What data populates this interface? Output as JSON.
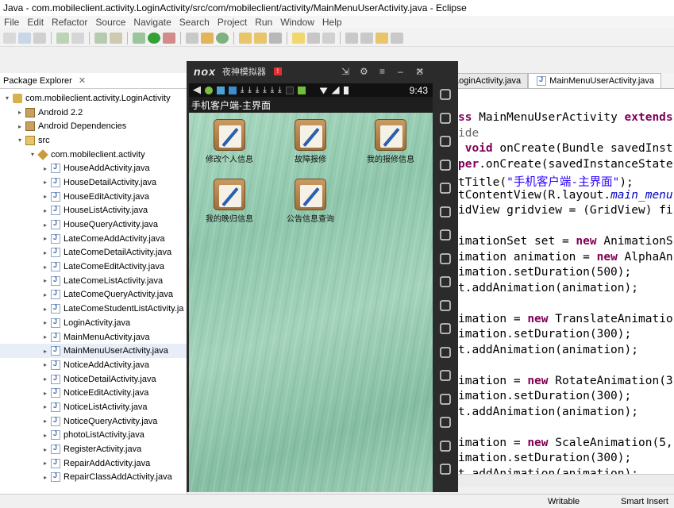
{
  "window": {
    "title": "Java - com.mobileclient.activity.LoginActivity/src/com/mobileclient/activity/MainMenuUserActivity.java - Eclipse"
  },
  "menu": [
    "File",
    "Edit",
    "Refactor",
    "Source",
    "Navigate",
    "Search",
    "Project",
    "Run",
    "Window",
    "Help"
  ],
  "explorer": {
    "title": "Package Explorer",
    "close": "✕",
    "items": [
      {
        "label": "com.mobileclient.activity.LoginActivity",
        "indent": 0,
        "icon": "project-icon",
        "twisty": "▾"
      },
      {
        "label": "Android 2.2",
        "indent": 1,
        "icon": "library-icon",
        "twisty": "▸"
      },
      {
        "label": "Android Dependencies",
        "indent": 1,
        "icon": "library-icon",
        "twisty": "▸"
      },
      {
        "label": "src",
        "indent": 1,
        "icon": "source-folder-icon",
        "twisty": "▾"
      },
      {
        "label": "com.mobileclient.activity",
        "indent": 2,
        "icon": "package-icon",
        "twisty": "▾"
      },
      {
        "label": "HouseAddActivity.java",
        "indent": 3,
        "icon": "java-file-icon",
        "twisty": "▸"
      },
      {
        "label": "HouseDetailActivity.java",
        "indent": 3,
        "icon": "java-file-icon",
        "twisty": "▸"
      },
      {
        "label": "HouseEditActivity.java",
        "indent": 3,
        "icon": "java-file-icon",
        "twisty": "▸"
      },
      {
        "label": "HouseListActivity.java",
        "indent": 3,
        "icon": "java-file-icon",
        "twisty": "▸"
      },
      {
        "label": "HouseQueryActivity.java",
        "indent": 3,
        "icon": "java-file-icon",
        "twisty": "▸"
      },
      {
        "label": "LateComeAddActivity.java",
        "indent": 3,
        "icon": "java-file-icon",
        "twisty": "▸"
      },
      {
        "label": "LateComeDetailActivity.java",
        "indent": 3,
        "icon": "java-file-icon",
        "twisty": "▸"
      },
      {
        "label": "LateComeEditActivity.java",
        "indent": 3,
        "icon": "java-file-icon",
        "twisty": "▸"
      },
      {
        "label": "LateComeListActivity.java",
        "indent": 3,
        "icon": "java-file-icon",
        "twisty": "▸"
      },
      {
        "label": "LateComeQueryActivity.java",
        "indent": 3,
        "icon": "java-file-icon",
        "twisty": "▸"
      },
      {
        "label": "LateComeStudentListActivity.ja",
        "indent": 3,
        "icon": "java-file-icon",
        "twisty": "▸"
      },
      {
        "label": "LoginActivity.java",
        "indent": 3,
        "icon": "java-file-icon",
        "twisty": "▸"
      },
      {
        "label": "MainMenuActivity.java",
        "indent": 3,
        "icon": "java-file-icon",
        "twisty": "▸"
      },
      {
        "label": "MainMenuUserActivity.java",
        "indent": 3,
        "icon": "java-file-icon",
        "twisty": "▸",
        "selected": true
      },
      {
        "label": "NoticeAddActivity.java",
        "indent": 3,
        "icon": "java-file-icon",
        "twisty": "▸"
      },
      {
        "label": "NoticeDetailActivity.java",
        "indent": 3,
        "icon": "java-file-icon",
        "twisty": "▸"
      },
      {
        "label": "NoticeEditActivity.java",
        "indent": 3,
        "icon": "java-file-icon",
        "twisty": "▸"
      },
      {
        "label": "NoticeListActivity.java",
        "indent": 3,
        "icon": "java-file-icon",
        "twisty": "▸"
      },
      {
        "label": "NoticeQueryActivity.java",
        "indent": 3,
        "icon": "java-file-icon",
        "twisty": "▸"
      },
      {
        "label": "photoListActivity.java",
        "indent": 3,
        "icon": "java-file-icon",
        "twisty": "▸"
      },
      {
        "label": "RegisterActivity.java",
        "indent": 3,
        "icon": "java-file-icon",
        "twisty": "▸"
      },
      {
        "label": "RepairAddActivity.java",
        "indent": 3,
        "icon": "java-file-icon",
        "twisty": "▸"
      },
      {
        "label": "RepairClassAddActivity.java",
        "indent": 3,
        "icon": "java-file-icon",
        "twisty": "▸"
      }
    ]
  },
  "editor": {
    "tabs": [
      {
        "label": "LoginActivity.java",
        "active": false
      },
      {
        "label": "MainMenuUserActivity.java",
        "active": true
      }
    ],
    "lines": [
      {
        "segments": [
          {
            "t": "ss ",
            "c": "kw"
          },
          {
            "t": "MainMenuUserActivity ",
            "c": ""
          },
          {
            "t": "extends",
            "c": "kw"
          }
        ]
      },
      {
        "segments": [
          {
            "t": "ide",
            "c": "ann"
          }
        ]
      },
      {
        "segments": [
          {
            "t": " ",
            "c": ""
          },
          {
            "t": "void",
            "c": "kw"
          },
          {
            "t": " onCreate(Bundle savedInst",
            "c": ""
          }
        ]
      },
      {
        "segments": [
          {
            "t": "per",
            "c": "kw"
          },
          {
            "t": ".onCreate(savedInstanceState",
            "c": ""
          }
        ]
      },
      {
        "segments": [
          {
            "t": "tTitle(",
            "c": ""
          },
          {
            "t": "\"手机客户端-主界面\"",
            "c": "str"
          },
          {
            "t": ");",
            "c": ""
          }
        ]
      },
      {
        "segments": [
          {
            "t": "tContentView(R.layout.",
            "c": ""
          },
          {
            "t": "main_menu",
            "c": "ital"
          }
        ]
      },
      {
        "segments": [
          {
            "t": "idView gridview = (GridView) fi",
            "c": ""
          }
        ]
      },
      {
        "segments": []
      },
      {
        "segments": [
          {
            "t": "imationSet set = ",
            "c": ""
          },
          {
            "t": "new",
            "c": "kw"
          },
          {
            "t": " AnimationS",
            "c": ""
          }
        ]
      },
      {
        "segments": [
          {
            "t": "imation animation = ",
            "c": ""
          },
          {
            "t": "new",
            "c": "kw"
          },
          {
            "t": " AlphaAn",
            "c": ""
          }
        ]
      },
      {
        "segments": [
          {
            "t": "imation.setDuration(500);",
            "c": ""
          }
        ]
      },
      {
        "segments": [
          {
            "t": "t.addAnimation(animation);",
            "c": ""
          }
        ]
      },
      {
        "segments": []
      },
      {
        "segments": [
          {
            "t": "imation = ",
            "c": ""
          },
          {
            "t": "new",
            "c": "kw"
          },
          {
            "t": " TranslateAnimatio",
            "c": ""
          }
        ]
      },
      {
        "segments": [
          {
            "t": "imation.setDuration(300);",
            "c": ""
          }
        ]
      },
      {
        "segments": [
          {
            "t": "t.addAnimation(animation);",
            "c": ""
          }
        ]
      },
      {
        "segments": []
      },
      {
        "segments": [
          {
            "t": "imation = ",
            "c": ""
          },
          {
            "t": "new",
            "c": "kw"
          },
          {
            "t": " RotateAnimation(3",
            "c": ""
          }
        ]
      },
      {
        "segments": [
          {
            "t": "imation.setDuration(300);",
            "c": ""
          }
        ]
      },
      {
        "segments": [
          {
            "t": "t.addAnimation(animation);",
            "c": ""
          }
        ]
      },
      {
        "segments": []
      },
      {
        "segments": [
          {
            "t": "imation = ",
            "c": ""
          },
          {
            "t": "new",
            "c": "kw"
          },
          {
            "t": " ScaleAnimation(5,",
            "c": ""
          }
        ]
      },
      {
        "segments": [
          {
            "t": "imation.setDuration(300);",
            "c": ""
          }
        ]
      },
      {
        "segments": [
          {
            "t": "t.addAnimation(animation);",
            "c": ""
          }
        ]
      }
    ]
  },
  "emulator": {
    "logo": "nox",
    "name": "夜神模拟器",
    "badge": "!",
    "controls": [
      "⇲",
      "⚙",
      "≡",
      "–",
      "□",
      "✕"
    ],
    "status_time": "9:43",
    "app_title": "手机客户端-主界面",
    "grid": [
      {
        "label": "修改个人信息"
      },
      {
        "label": "故障报修"
      },
      {
        "label": "我的报修信息"
      },
      {
        "label": "我的晚归信息"
      },
      {
        "label": "公告信息查询"
      }
    ],
    "side_icons": [
      "menu-dots-icon",
      "phone-shake-icon",
      "keyboard-icon",
      "scissors-icon",
      "apk-icon",
      "screen-icon",
      "fullscreen-icon",
      "volume-up-icon",
      "volume-down-icon",
      "loading-icon",
      "screenshot-icon",
      "recorder-icon",
      "multi-instance-icon",
      "more-icon",
      "back-icon",
      "home-icon",
      "recent-apps-icon"
    ]
  },
  "status": {
    "writable": "Writable",
    "insert": "Smart Insert"
  }
}
